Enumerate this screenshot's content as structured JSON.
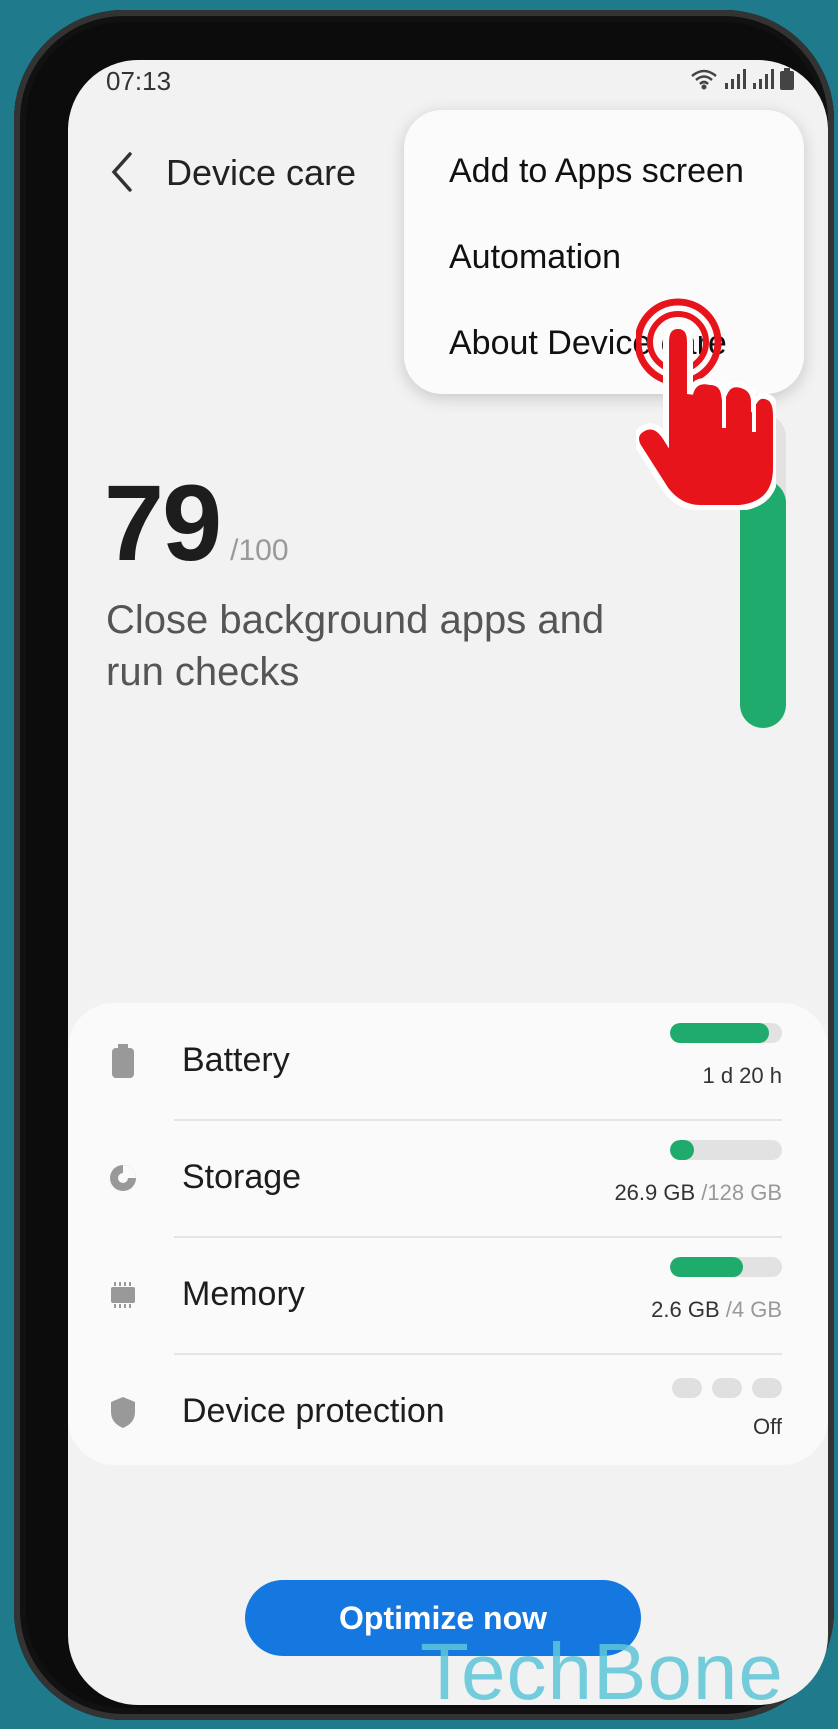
{
  "status_bar": {
    "time": "07:13"
  },
  "app_bar": {
    "title": "Device care"
  },
  "menu": {
    "items": [
      {
        "label": "Add to Apps screen"
      },
      {
        "label": "Automation"
      },
      {
        "label": "About Device care"
      }
    ]
  },
  "score": {
    "value": "79",
    "max": "/100",
    "level_fraction": 0.79,
    "description": "Close background apps and run checks"
  },
  "rows": [
    {
      "label": "Battery",
      "value": "1 d 20 h",
      "value_muted": "",
      "fill_fraction": 0.88
    },
    {
      "label": "Storage",
      "value": "26.9 GB",
      "value_muted": "/128 GB",
      "fill_fraction": 0.21
    },
    {
      "label": "Memory",
      "value": "2.6 GB",
      "value_muted": "/4 GB",
      "fill_fraction": 0.65
    },
    {
      "label": "Device protection",
      "value": "Off",
      "value_muted": ""
    }
  ],
  "actions": {
    "optimize_label": "Optimize now"
  },
  "watermark": "TechBone",
  "colors": {
    "accent": "#1478e0",
    "good": "#1fab6c",
    "tap_indicator": "#e8141c"
  }
}
